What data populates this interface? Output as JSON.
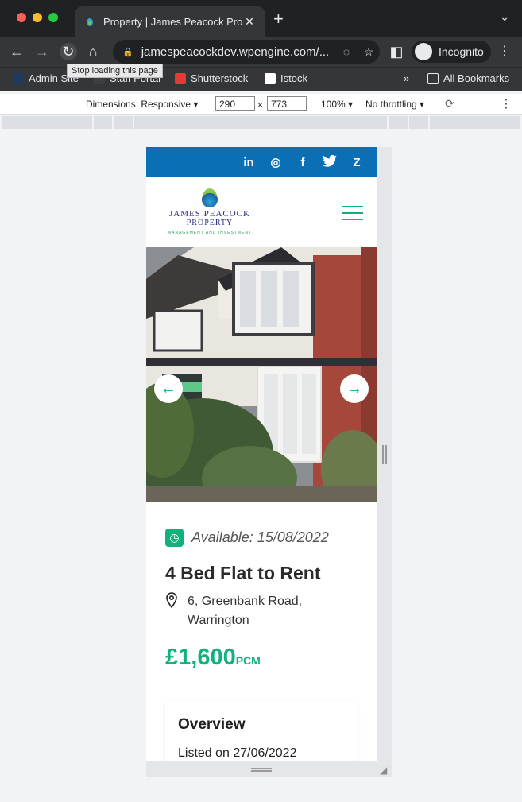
{
  "browser": {
    "tab_title": "Property | James Peacock Prop",
    "url": "jamespeacockdev.wpengine.com/...",
    "tooltip": "Stop loading this page",
    "profile": "Incognito",
    "bookmarks": [
      "Admin Site",
      "Staff Portal",
      "Shutterstock",
      "Istock"
    ],
    "all_bookmarks": "All Bookmarks",
    "colors": {
      "frame": "#202124",
      "toolbar": "#35363a"
    }
  },
  "devtools": {
    "dimensions_label": "Dimensions: Responsive",
    "width": "290",
    "height": "773",
    "times": "×",
    "zoom": "100%",
    "throttling": "No throttling"
  },
  "site": {
    "social_icons": [
      "linkedin-icon",
      "instagram-icon",
      "facebook-icon",
      "twitter-icon",
      "zoopla-icon"
    ],
    "social_labels": [
      "in",
      "◎",
      "f",
      "🐦",
      "Z"
    ],
    "logo": {
      "line1": "JAMES PEACOCK",
      "line2": "PROPERTY",
      "line3": "MANAGEMENT AND INVESTMENT"
    },
    "colors": {
      "top_bar": "#0a6fb5",
      "accent": "#10b27a"
    },
    "property": {
      "available": "Available: 15/08/2022",
      "title": "4 Bed Flat to Rent",
      "address_line1": "6, Greenbank Road,",
      "address_line2": "Warrington",
      "price": "£1,600",
      "price_unit": "PCM"
    },
    "overview": {
      "heading": "Overview",
      "listed": "Listed on 27/06/2022"
    }
  }
}
